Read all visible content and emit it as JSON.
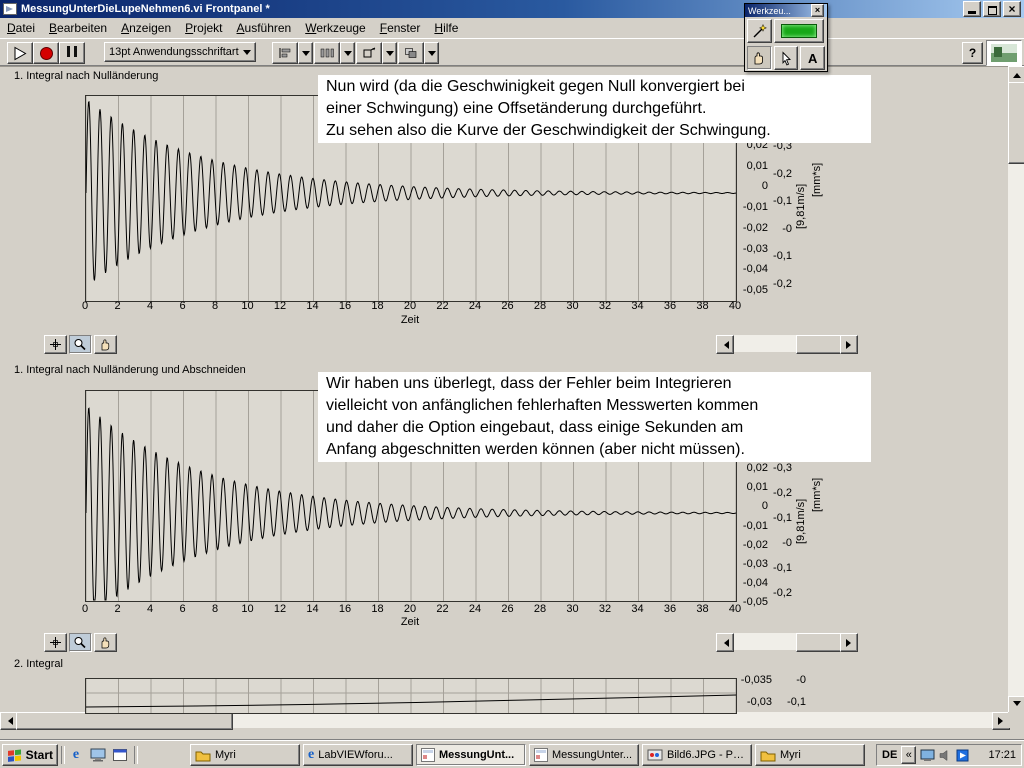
{
  "window": {
    "title": "MessungUnterDieLupeNehmen6.vi Frontpanel *"
  },
  "icons": {
    "close": "×",
    "browser_glyph": "e"
  },
  "menu": {
    "items": [
      "Datei",
      "Bearbeiten",
      "Anzeigen",
      "Projekt",
      "Ausführen",
      "Werkzeuge",
      "Fenster",
      "Hilfe"
    ]
  },
  "toolbar": {
    "font_selector": "13pt Anwendungsschriftart",
    "help_label": "?"
  },
  "tools_palette": {
    "title": "Werkzeu...",
    "text_tool_label": "A"
  },
  "charts": [
    {
      "label": "1. Integral nach Nulländerung",
      "note_lines": [
        "Nun wird (da die Geschwinigkeit gegen Null konvergiert bei",
        "einer Schwingung) eine Offsetänderung durchgeführt.",
        "Zu sehen also die Kurve der Geschwindigkeit der Schwingung."
      ],
      "y_ticks": [
        "0,02",
        "0,01",
        "0",
        "-0,01",
        "-0,02",
        "-0,03",
        "-0,04",
        "-0,05"
      ],
      "y2_ticks": [
        "-0,3",
        "-0,2",
        "-0,1",
        "-0",
        "-0,1",
        "-0,2"
      ],
      "unit_labels": [
        "[9,81m/s]",
        "[mm*s]"
      ],
      "x_ticks": [
        "0",
        "2",
        "4",
        "6",
        "8",
        "10",
        "12",
        "14",
        "16",
        "18",
        "20",
        "22",
        "24",
        "26",
        "28",
        "30",
        "32",
        "34",
        "36",
        "38",
        "40"
      ],
      "x_label": "Zeit"
    },
    {
      "label": "1. Integral nach Nulländerung und Abschneiden",
      "note_lines": [
        "Wir haben uns überlegt, dass der Fehler beim Integrieren",
        "vielleicht von anfänglichen fehlerhaften Messwerten kommen",
        "und daher die Option eingebaut, dass einige Sekunden am",
        "Anfang abgeschnitten werden können (aber nicht müssen)."
      ],
      "y_ticks": [
        "0,02",
        "0,01",
        "0",
        "-0,01",
        "-0,02",
        "-0,03",
        "-0,04",
        "-0,05"
      ],
      "y2_ticks": [
        "-0,3",
        "-0,2",
        "-0,1",
        "-0",
        "-0,1",
        "-0,2"
      ],
      "unit_labels": [
        "[9,81m/s]",
        "[mm*s]"
      ],
      "x_ticks": [
        "0",
        "2",
        "4",
        "6",
        "8",
        "10",
        "12",
        "14",
        "16",
        "18",
        "20",
        "22",
        "24",
        "26",
        "28",
        "30",
        "32",
        "34",
        "36",
        "38",
        "40"
      ],
      "x_label": "Zeit"
    },
    {
      "label": "2. Integral",
      "y_ticks": [
        "-0,035",
        "-0,03"
      ],
      "y2_ticks": [
        "-0",
        "-0,1"
      ],
      "unit_labels": [],
      "x_ticks": []
    }
  ],
  "chart_data": [
    {
      "type": "line",
      "title": "1. Integral nach Nulländerung",
      "xlabel": "Zeit",
      "x_range": [
        0,
        40
      ],
      "x_tick_values": [
        0,
        2,
        4,
        6,
        8,
        10,
        12,
        14,
        16,
        18,
        20,
        22,
        24,
        26,
        28,
        30,
        32,
        34,
        36,
        38,
        40
      ],
      "y_tick_values": [
        0.02,
        0.01,
        0,
        -0.01,
        -0.02,
        -0.03,
        -0.04,
        -0.05
      ],
      "secondary_y_tick_labels": [
        "-0,3",
        "-0,2",
        "-0,1",
        "-0",
        "-0,1",
        "-0,2"
      ],
      "secondary_y_units": [
        "[9,81m/s]",
        "[mm*s]"
      ],
      "signal": "damped_sine",
      "amplitude_initial": 0.05,
      "decay_time_constant": 7.5,
      "frequency": 1.45,
      "steady_state": 0,
      "grid": "vertical"
    },
    {
      "type": "line",
      "title": "1. Integral nach Nulländerung und Abschneiden",
      "xlabel": "Zeit",
      "x_range": [
        0,
        40
      ],
      "x_tick_values": [
        0,
        2,
        4,
        6,
        8,
        10,
        12,
        14,
        16,
        18,
        20,
        22,
        24,
        26,
        28,
        30,
        32,
        34,
        36,
        38,
        40
      ],
      "y_tick_values": [
        0.02,
        0.01,
        0,
        -0.01,
        -0.02,
        -0.03,
        -0.04,
        -0.05
      ],
      "secondary_y_tick_labels": [
        "-0,3",
        "-0,2",
        "-0,1",
        "-0",
        "-0,1",
        "-0,2"
      ],
      "secondary_y_units": [
        "[9,81m/s]",
        "[mm*s]"
      ],
      "signal": "damped_sine",
      "amplitude_initial": 0.05,
      "decay_time_constant": 7.5,
      "frequency": 1.45,
      "steady_state": 0,
      "grid": "vertical"
    },
    {
      "type": "line",
      "title": "2. Integral",
      "y_tick_values": [
        -0.035,
        -0.03
      ],
      "secondary_y_tick_labels": [
        "-0",
        "-0,1"
      ],
      "signal": "slow_rising_curve",
      "visible": "partial (clipped by window scroll)"
    }
  ],
  "taskbar": {
    "start_label": "Start",
    "tasks": [
      {
        "label": "Myri",
        "icon": "folder-icon",
        "active": false
      },
      {
        "label": "LabVIEWforu...",
        "icon": "browser-icon",
        "active": false
      },
      {
        "label": "MessungUnt...",
        "icon": "vi-icon",
        "active": true
      },
      {
        "label": "MessungUnter...",
        "icon": "vi-icon",
        "active": false
      },
      {
        "label": "Bild6.JPG - Paint",
        "icon": "paint-icon",
        "active": false
      },
      {
        "label": "Myri",
        "icon": "folder-icon",
        "active": false
      }
    ],
    "tray": {
      "language": "DE",
      "chevron": "«",
      "time": "17:21"
    }
  }
}
